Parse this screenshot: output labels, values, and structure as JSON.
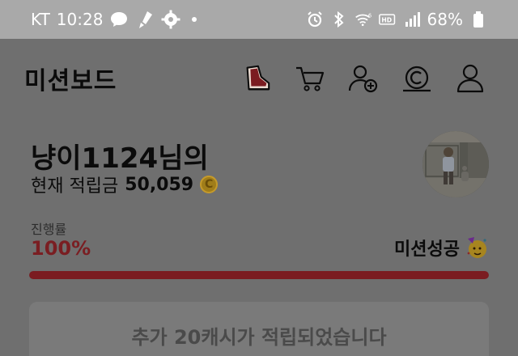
{
  "status_bar": {
    "carrier": "KT",
    "time": "10:28",
    "battery": "68%",
    "icons": [
      "messenger-icon",
      "rocket-icon",
      "settings-gear-icon",
      "alarm-icon",
      "bluetooth-icon",
      "wifi-6-icon",
      "hd-voice-icon",
      "signal-icon",
      "battery-icon"
    ]
  },
  "header": {
    "title": "미션보드",
    "icons": [
      "sneaker-icon",
      "cart-icon",
      "add-friend-icon",
      "cash-coin-icon",
      "profile-icon"
    ]
  },
  "profile": {
    "username": "냥이1124님의",
    "balance_label": "현재 적립금",
    "balance_value": "50,059",
    "coin_symbol": "C"
  },
  "progress": {
    "label": "진행률",
    "value_text": "100%",
    "fraction": 1.0,
    "status": "미션성공"
  },
  "notice": {
    "text": "추가 20캐시가 적립되었습니다"
  },
  "colors": {
    "accent": "#7b1c21",
    "overlay": "#6f6f6f",
    "coin": "#a07d1a"
  }
}
